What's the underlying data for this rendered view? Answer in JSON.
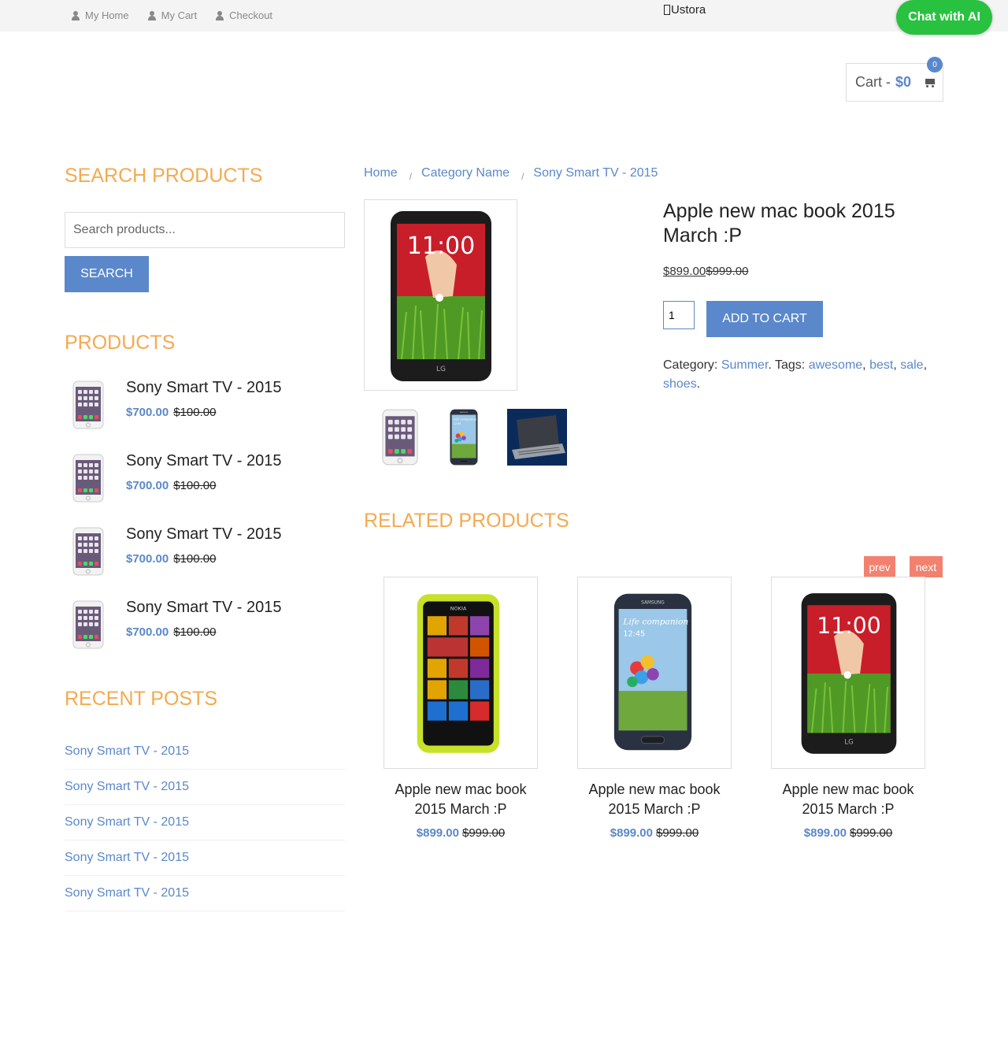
{
  "topnav": {
    "items": [
      {
        "label": "My Home"
      },
      {
        "label": "My Cart"
      },
      {
        "label": "Checkout"
      }
    ],
    "brand": "Ustora",
    "chat_label": "Chat with AI"
  },
  "cart": {
    "label": "Cart - ",
    "amount": "$0",
    "count": "0",
    "icon": "shopping-cart-icon"
  },
  "sidebar": {
    "search_title": "SEARCH PRODUCTS",
    "search_placeholder": "Search products...",
    "search_button": "SEARCH",
    "products_title": "PRODUCTS",
    "products": [
      {
        "name": "Sony Smart TV - 2015",
        "price": "$700.00",
        "old_price": "$100.00"
      },
      {
        "name": "Sony Smart TV - 2015",
        "price": "$700.00",
        "old_price": "$100.00"
      },
      {
        "name": "Sony Smart TV - 2015",
        "price": "$700.00",
        "old_price": "$100.00"
      },
      {
        "name": "Sony Smart TV - 2015",
        "price": "$700.00",
        "old_price": "$100.00"
      }
    ],
    "recent_title": "RECENT POSTS",
    "recent_posts": [
      "Sony Smart TV - 2015",
      "Sony Smart TV - 2015",
      "Sony Smart TV - 2015",
      "Sony Smart TV - 2015",
      "Sony Smart TV - 2015"
    ]
  },
  "breadcrumb": [
    "Home",
    "Category Name",
    "Sony Smart TV - 2015"
  ],
  "product": {
    "title": "Apple new mac book 2015 March :P",
    "price": "$899.00",
    "old_price": "$999.00",
    "quantity": "1",
    "add_to_cart": "ADD TO CART",
    "category_label": "Category: ",
    "category": "Summer",
    "tags_label": ". Tags: ",
    "tags": [
      "awesome",
      "best",
      "sale",
      "shoes"
    ]
  },
  "related": {
    "title": "RELATED PRODUCTS",
    "prev": "prev",
    "next": "next",
    "items": [
      {
        "name": "Apple new mac book 2015 March :P",
        "price": "$899.00",
        "old_price": "$999.00"
      },
      {
        "name": "Apple new mac book 2015 March :P",
        "price": "$899.00",
        "old_price": "$999.00"
      },
      {
        "name": "Apple new mac book 2015 March :P",
        "price": "$899.00",
        "old_price": "$999.00"
      }
    ]
  },
  "colors": {
    "accent": "#5a88ca",
    "heading": "#f5a94f",
    "chat": "#28c140",
    "carousel": "#f28170"
  }
}
